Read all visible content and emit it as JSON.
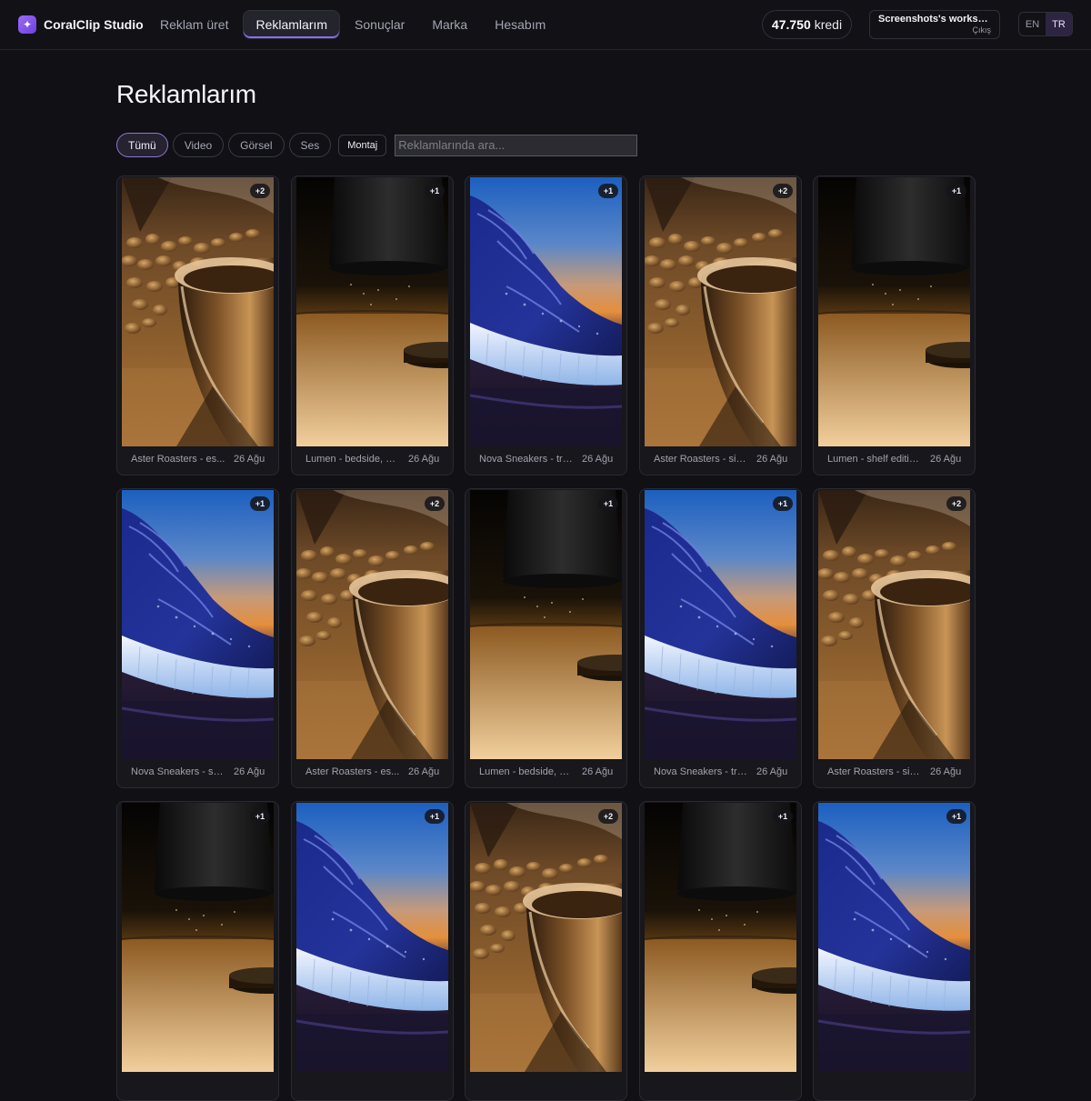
{
  "app": {
    "name": "CoralClip Studio",
    "logo_icon": "sparkle-icon"
  },
  "nav": {
    "items": [
      {
        "label": "Reklam üret",
        "active": false
      },
      {
        "label": "Reklamlarım",
        "active": true
      },
      {
        "label": "Sonuçlar",
        "active": false
      },
      {
        "label": "Marka",
        "active": false
      },
      {
        "label": "Hesabım",
        "active": false
      }
    ]
  },
  "credits": {
    "amount": "47.750",
    "unit": "kredi"
  },
  "workspace": {
    "name": "Screenshots's workspa...",
    "logout": "Çıkış"
  },
  "lang": {
    "en": "EN",
    "tr": "TR",
    "selected": "TR"
  },
  "page": {
    "title": "Reklamlarım"
  },
  "filters": {
    "chips": [
      {
        "label": "Tümü",
        "active": true
      },
      {
        "label": "Video",
        "active": false
      },
      {
        "label": "Görsel",
        "active": false
      },
      {
        "label": "Ses",
        "active": false
      }
    ],
    "montaj": "Montaj",
    "search_placeholder": "Reklamlarında ara..."
  },
  "colors": {
    "accent": "#8b6cf0",
    "background": "#101015",
    "card": "#17171c"
  },
  "ads": [
    {
      "name": "Aster Roasters - es...",
      "date": "26 Ağu",
      "badge": "+2",
      "image": "coffee"
    },
    {
      "name": "Lumen - bedside, di...",
      "date": "26 Ağu",
      "badge": "+1",
      "image": "lamp"
    },
    {
      "name": "Nova Sneakers - tra...",
      "date": "26 Ağu",
      "badge": "+1",
      "image": "sneaker"
    },
    {
      "name": "Aster Roasters - sin...",
      "date": "26 Ağu",
      "badge": "+2",
      "image": "coffee"
    },
    {
      "name": "Lumen - shelf editio...",
      "date": "26 Ağu",
      "badge": "+1",
      "image": "lamp"
    },
    {
      "name": "Nova Sneakers - sol...",
      "date": "26 Ağu",
      "badge": "+1",
      "image": "sneaker"
    },
    {
      "name": "Aster Roasters - es...",
      "date": "26 Ağu",
      "badge": "+2",
      "image": "coffee"
    },
    {
      "name": "Lumen - bedside, di...",
      "date": "26 Ağu",
      "badge": "+1",
      "image": "lamp"
    },
    {
      "name": "Nova Sneakers - tra...",
      "date": "26 Ağu",
      "badge": "+1",
      "image": "sneaker"
    },
    {
      "name": "Aster Roasters - sin...",
      "date": "26 Ağu",
      "badge": "+2",
      "image": "coffee"
    },
    {
      "badge": "+1",
      "image": "lamp"
    },
    {
      "badge": "+1",
      "image": "sneaker"
    },
    {
      "badge": "+2",
      "image": "coffee"
    },
    {
      "badge": "+1",
      "image": "lamp"
    },
    {
      "badge": "+1",
      "image": "sneaker"
    }
  ]
}
